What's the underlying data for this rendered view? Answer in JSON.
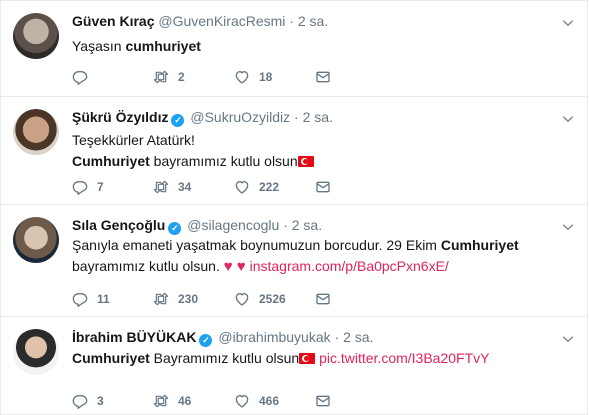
{
  "tweets": [
    {
      "name": "Güven Kıraç",
      "handle": "@GuvenKiracResmi",
      "time": "2 sa.",
      "verified": false,
      "text_plain_1": "Yaşasın ",
      "text_bold_1": "cumhuriyet",
      "replies": "",
      "retweets": "2",
      "likes": "18"
    },
    {
      "name": "Şükrü Özyıldız",
      "handle": "@SukruOzyildiz",
      "time": "2 sa.",
      "verified": true,
      "line1": "Teşekkürler Atatürk!",
      "text_bold_1": "Cumhuriyet",
      "text_plain_1": " bayramımız kutlu olsun",
      "replies": "7",
      "retweets": "34",
      "likes": "222"
    },
    {
      "name": "Sıla Gençoğlu",
      "handle": "@silagencoglu",
      "time": "2 sa.",
      "verified": true,
      "text_plain_1": "Şanıyla emaneti yaşatmak boynumuzun borcudur. 29 Ekim ",
      "text_bold_1": "Cumhuriyet",
      "text_plain_2": "bayramımız kutlu olsun. ",
      "link": "instagram.com/p/Ba0pcPxn6xE/",
      "replies": "11",
      "retweets": "230",
      "likes": "2526"
    },
    {
      "name": "İbrahim BÜYÜKAK",
      "handle": "@ibrahimbuyukak",
      "time": "2 sa.",
      "verified": true,
      "text_bold_1": "Cumhuriyet",
      "text_plain_1": " Bayramımız kutlu olsun",
      "link": "pic.twitter.com/I3Ba20FTvY",
      "replies": "3",
      "retweets": "46",
      "likes": "466"
    }
  ],
  "separator": "·",
  "verified_mark": "✓",
  "hearts": "♥ ♥",
  "colors": {
    "link": "#e0245e",
    "verified": "#1da1f2",
    "muted": "#657786"
  }
}
